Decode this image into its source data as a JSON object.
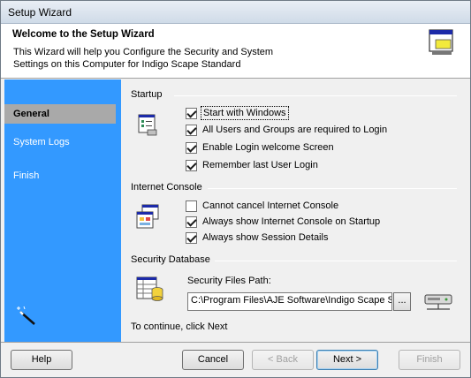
{
  "window": {
    "title": "Setup Wizard"
  },
  "header": {
    "title": "Welcome to the Setup Wizard",
    "description": "This Wizard will help you Configure the Security and System Settings on this Computer for Indigo Scape Standard",
    "icon": "window-setup-icon"
  },
  "sidebar": {
    "items": [
      {
        "label": "General",
        "active": true
      },
      {
        "label": "System Logs",
        "active": false
      },
      {
        "label": "Finish",
        "active": false
      }
    ],
    "icon": "magic-wand-icon"
  },
  "startup": {
    "title": "Startup",
    "icon": "startup-settings-icon",
    "options": [
      {
        "label": "Start with Windows",
        "checked": true
      },
      {
        "label": "All Users and Groups are required to Login",
        "checked": true
      },
      {
        "label": "Enable Login welcome Screen",
        "checked": true
      },
      {
        "label": "Remember last User Login",
        "checked": true
      }
    ]
  },
  "internet_console": {
    "title": "Internet Console",
    "icon": "console-windows-icon",
    "options": [
      {
        "label": "Cannot cancel Internet Console",
        "checked": false
      },
      {
        "label": "Always show Internet Console on Startup",
        "checked": true
      },
      {
        "label": "Always show Session Details",
        "checked": true
      }
    ]
  },
  "security_database": {
    "title": "Security Database",
    "icon": "database-icon",
    "path_label": "Security Files Path:",
    "path_value": "C:\\Program Files\\AJE Software\\Indigo Scape Standard",
    "browse_label": "...",
    "network_icon": "network-drive-icon"
  },
  "continue_text": "To continue, click Next",
  "buttons": {
    "help": "Help",
    "cancel": "Cancel",
    "back": "< Back",
    "next": "Next >",
    "finish": "Finish"
  },
  "colors": {
    "sidebar": "#3399ff",
    "active_item": "#a9a9a9"
  }
}
